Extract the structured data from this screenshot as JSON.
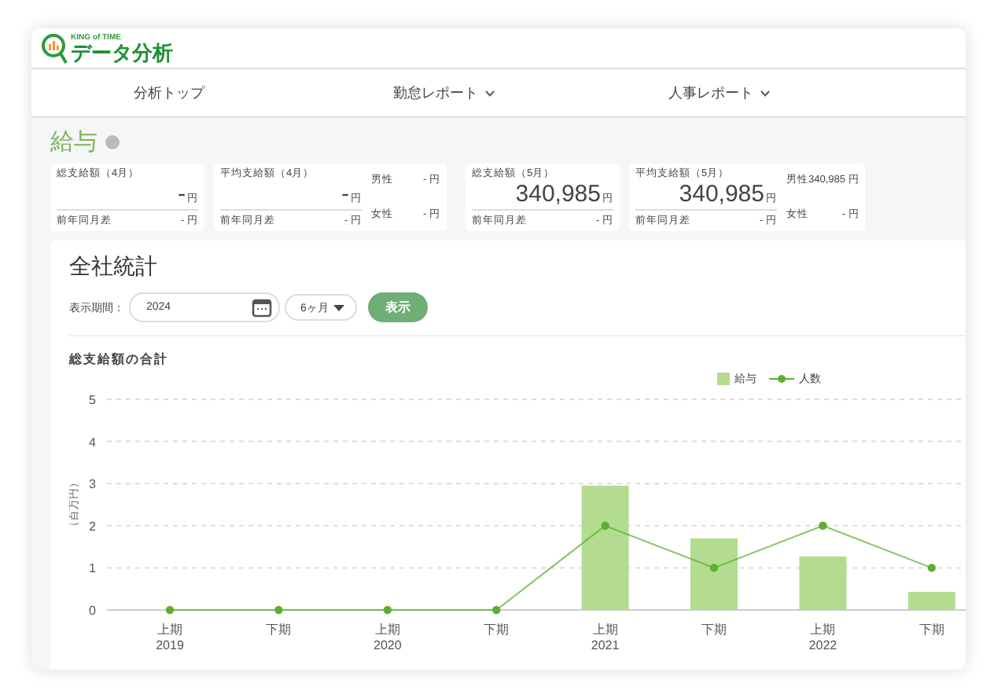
{
  "logo": {
    "brand": "KING of TIME",
    "title": "データ分析"
  },
  "nav": [
    {
      "label": "分析トップ",
      "dropdown": false
    },
    {
      "label": "勤怠レポート",
      "dropdown": true
    },
    {
      "label": "人事レポート",
      "dropdown": true
    }
  ],
  "section": {
    "title": "給与"
  },
  "stat_groups": [
    {
      "cards": [
        {
          "title": "総支給額（4月）",
          "value": "-",
          "unit": "円",
          "diff_label": "前年同月差",
          "diff_value": "- 円"
        },
        {
          "title": "平均支給額（4月）",
          "value": "-",
          "unit": "円",
          "diff_label": "前年同月差",
          "diff_value": "- 円",
          "breakdown": [
            {
              "label": "男性",
              "value": "- 円"
            },
            {
              "label": "女性",
              "value": "- 円"
            }
          ]
        }
      ]
    },
    {
      "cards": [
        {
          "title": "総支給額（5月）",
          "value": "340,985",
          "unit": "円",
          "diff_label": "前年同月差",
          "diff_value": "- 円"
        },
        {
          "title": "平均支給額（5月）",
          "value": "340,985",
          "unit": "円",
          "diff_label": "前年同月差",
          "diff_value": "- 円",
          "breakdown": [
            {
              "label": "男性",
              "value": "340,985 円"
            },
            {
              "label": "女性",
              "value": "- 円"
            }
          ]
        }
      ]
    }
  ],
  "panel": {
    "title": "全社統計",
    "period_label": "表示期間：",
    "year": "2024",
    "span": "6ヶ月",
    "show_button": "表示"
  },
  "chart": {
    "title": "総支給額の合計",
    "chart_data": {
      "type": "bar",
      "ylabel": "（百万円）",
      "categories": [
        "上期\n2019",
        "下期",
        "上期\n2020",
        "下期",
        "上期\n2021",
        "下期",
        "上期\n2022",
        "下期"
      ],
      "series": [
        {
          "name": "給与",
          "color": "#b3dc90",
          "type": "bar",
          "values": [
            0,
            0,
            0,
            0,
            2.95,
            1.7,
            1.27,
            0.43
          ]
        },
        {
          "name": "人数",
          "color": "#5cb030",
          "type": "line",
          "marker": "circle",
          "values": [
            0,
            0,
            0,
            0,
            2,
            1,
            2,
            1
          ]
        }
      ],
      "ylim": [
        0,
        5
      ],
      "yticks": [
        0,
        1,
        2,
        3,
        4,
        5
      ],
      "grid": true,
      "legend": true
    }
  }
}
